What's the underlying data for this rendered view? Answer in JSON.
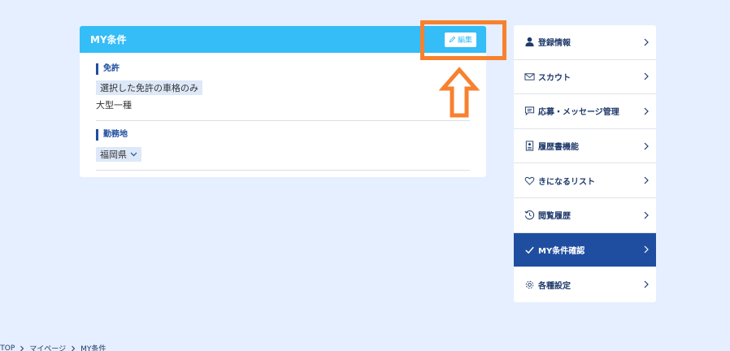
{
  "card": {
    "title": "MY条件",
    "edit_label": "編集",
    "license": {
      "label": "免許",
      "tag": "選択した免許の車格のみ",
      "value": "大型一種"
    },
    "workplace": {
      "label": "勤務地",
      "tag": "福岡県"
    }
  },
  "sidebar": {
    "items": [
      {
        "label": "登録情報",
        "icon": "person-icon"
      },
      {
        "label": "スカウト",
        "icon": "scout-mail-icon"
      },
      {
        "label": "応募・メッセージ管理",
        "icon": "message-icon"
      },
      {
        "label": "履歴書機能",
        "icon": "resume-icon"
      },
      {
        "label": "きになるリスト",
        "icon": "heart-icon"
      },
      {
        "label": "閲覧履歴",
        "icon": "history-icon"
      },
      {
        "label": "MY条件確認",
        "icon": "check-icon",
        "active": true
      },
      {
        "label": "各種設定",
        "icon": "gear-icon"
      }
    ]
  },
  "breadcrumb": {
    "items": [
      "P TOP",
      "マイページ",
      "MY条件"
    ]
  },
  "colors": {
    "header_blue": "#34bdf6",
    "navy": "#1f4ea1",
    "annotation_orange": "#f7812f",
    "background": "#e5efff"
  }
}
